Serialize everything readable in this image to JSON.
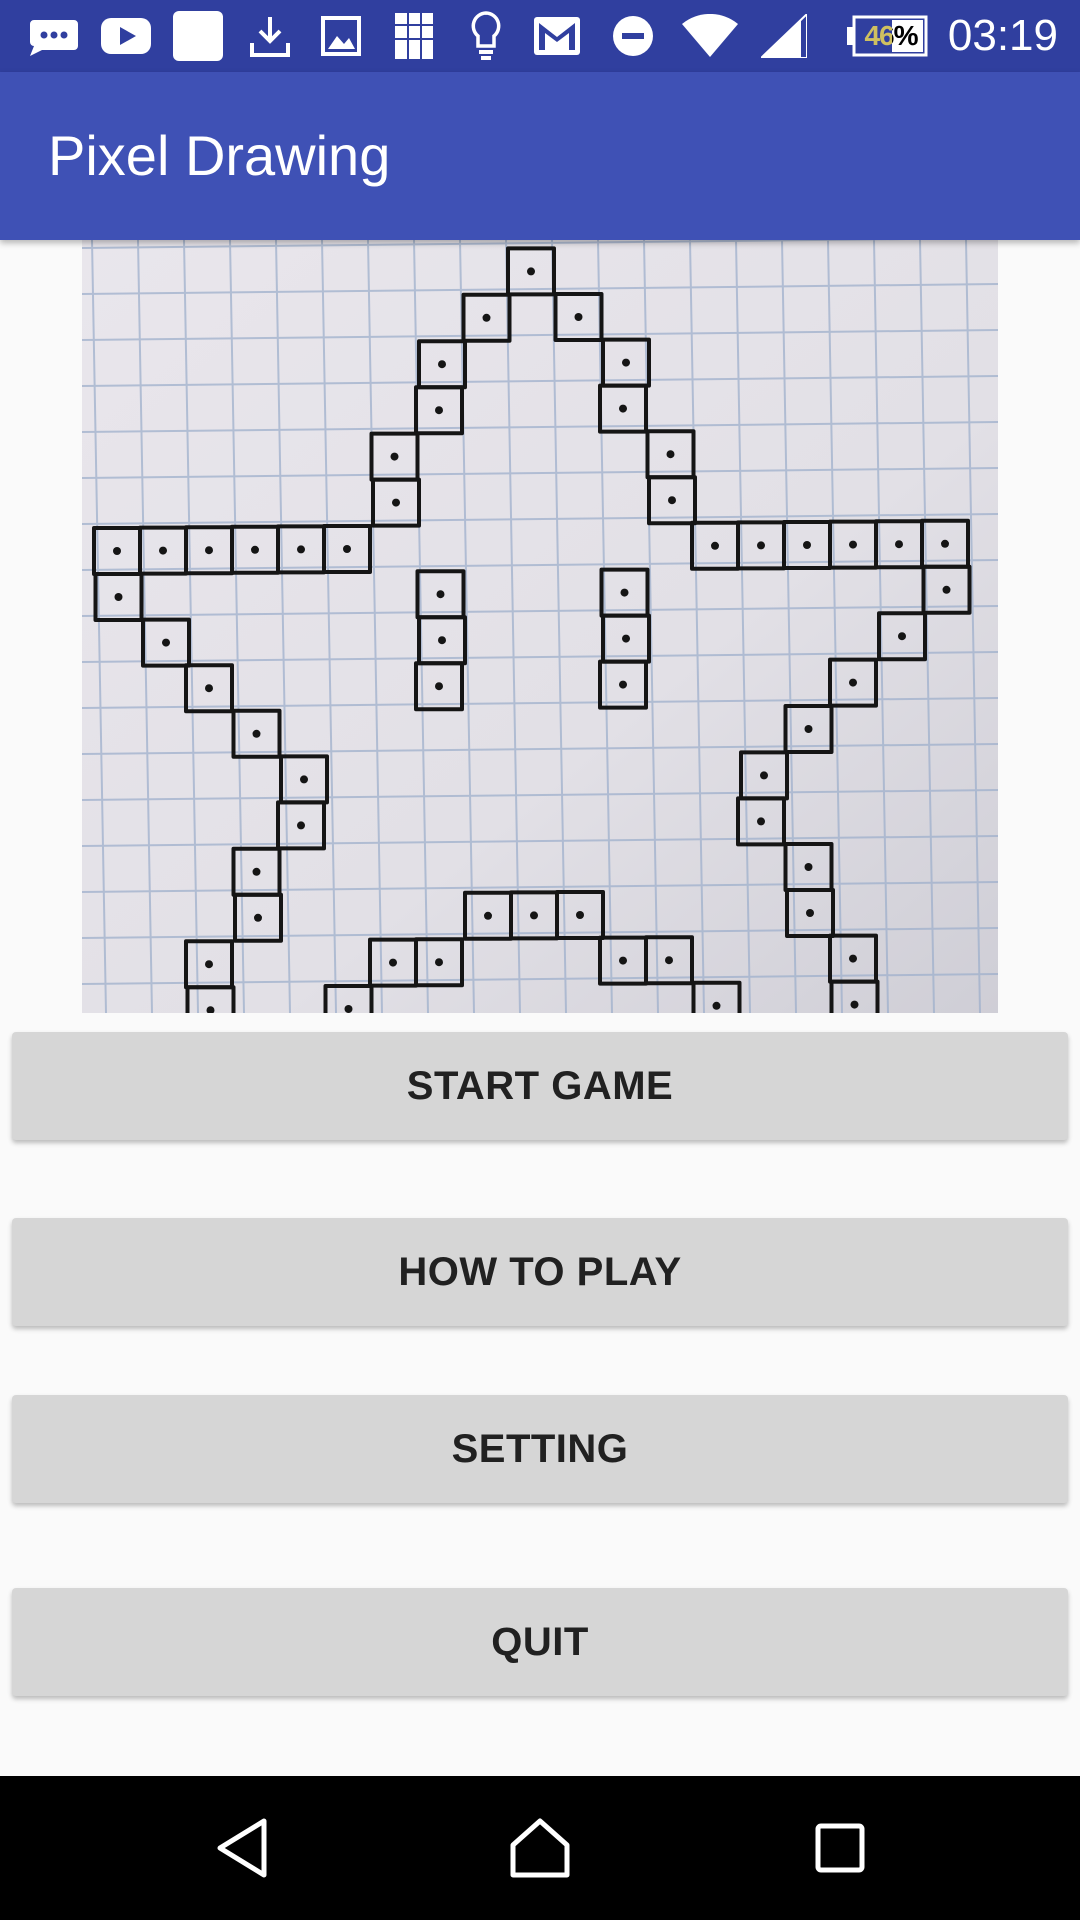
{
  "status_bar": {
    "icons": [
      "sms-icon",
      "youtube-icon",
      "blank-app-icon",
      "download-icon",
      "image-icon",
      "gallery-icon",
      "lightbulb-icon",
      "gmail-icon",
      "do-not-disturb-icon",
      "wifi-icon",
      "signal-icon",
      "battery-icon"
    ],
    "battery_percent": "46%",
    "time": "03:19"
  },
  "app_bar": {
    "title": "Pixel Drawing"
  },
  "main": {
    "image_description_icon": "star-pixel-drawing",
    "buttons": {
      "start": "START GAME",
      "how_to_play": "HOW TO PLAY",
      "setting": "SETTING",
      "quit": "QUIT"
    }
  },
  "nav_bar": {
    "icons": [
      "back-icon",
      "home-icon",
      "recents-icon"
    ]
  },
  "colors": {
    "status_bar": "#303f9f",
    "app_bar": "#3f51b5",
    "button": "#d6d6d6",
    "background": "#fafafa"
  }
}
